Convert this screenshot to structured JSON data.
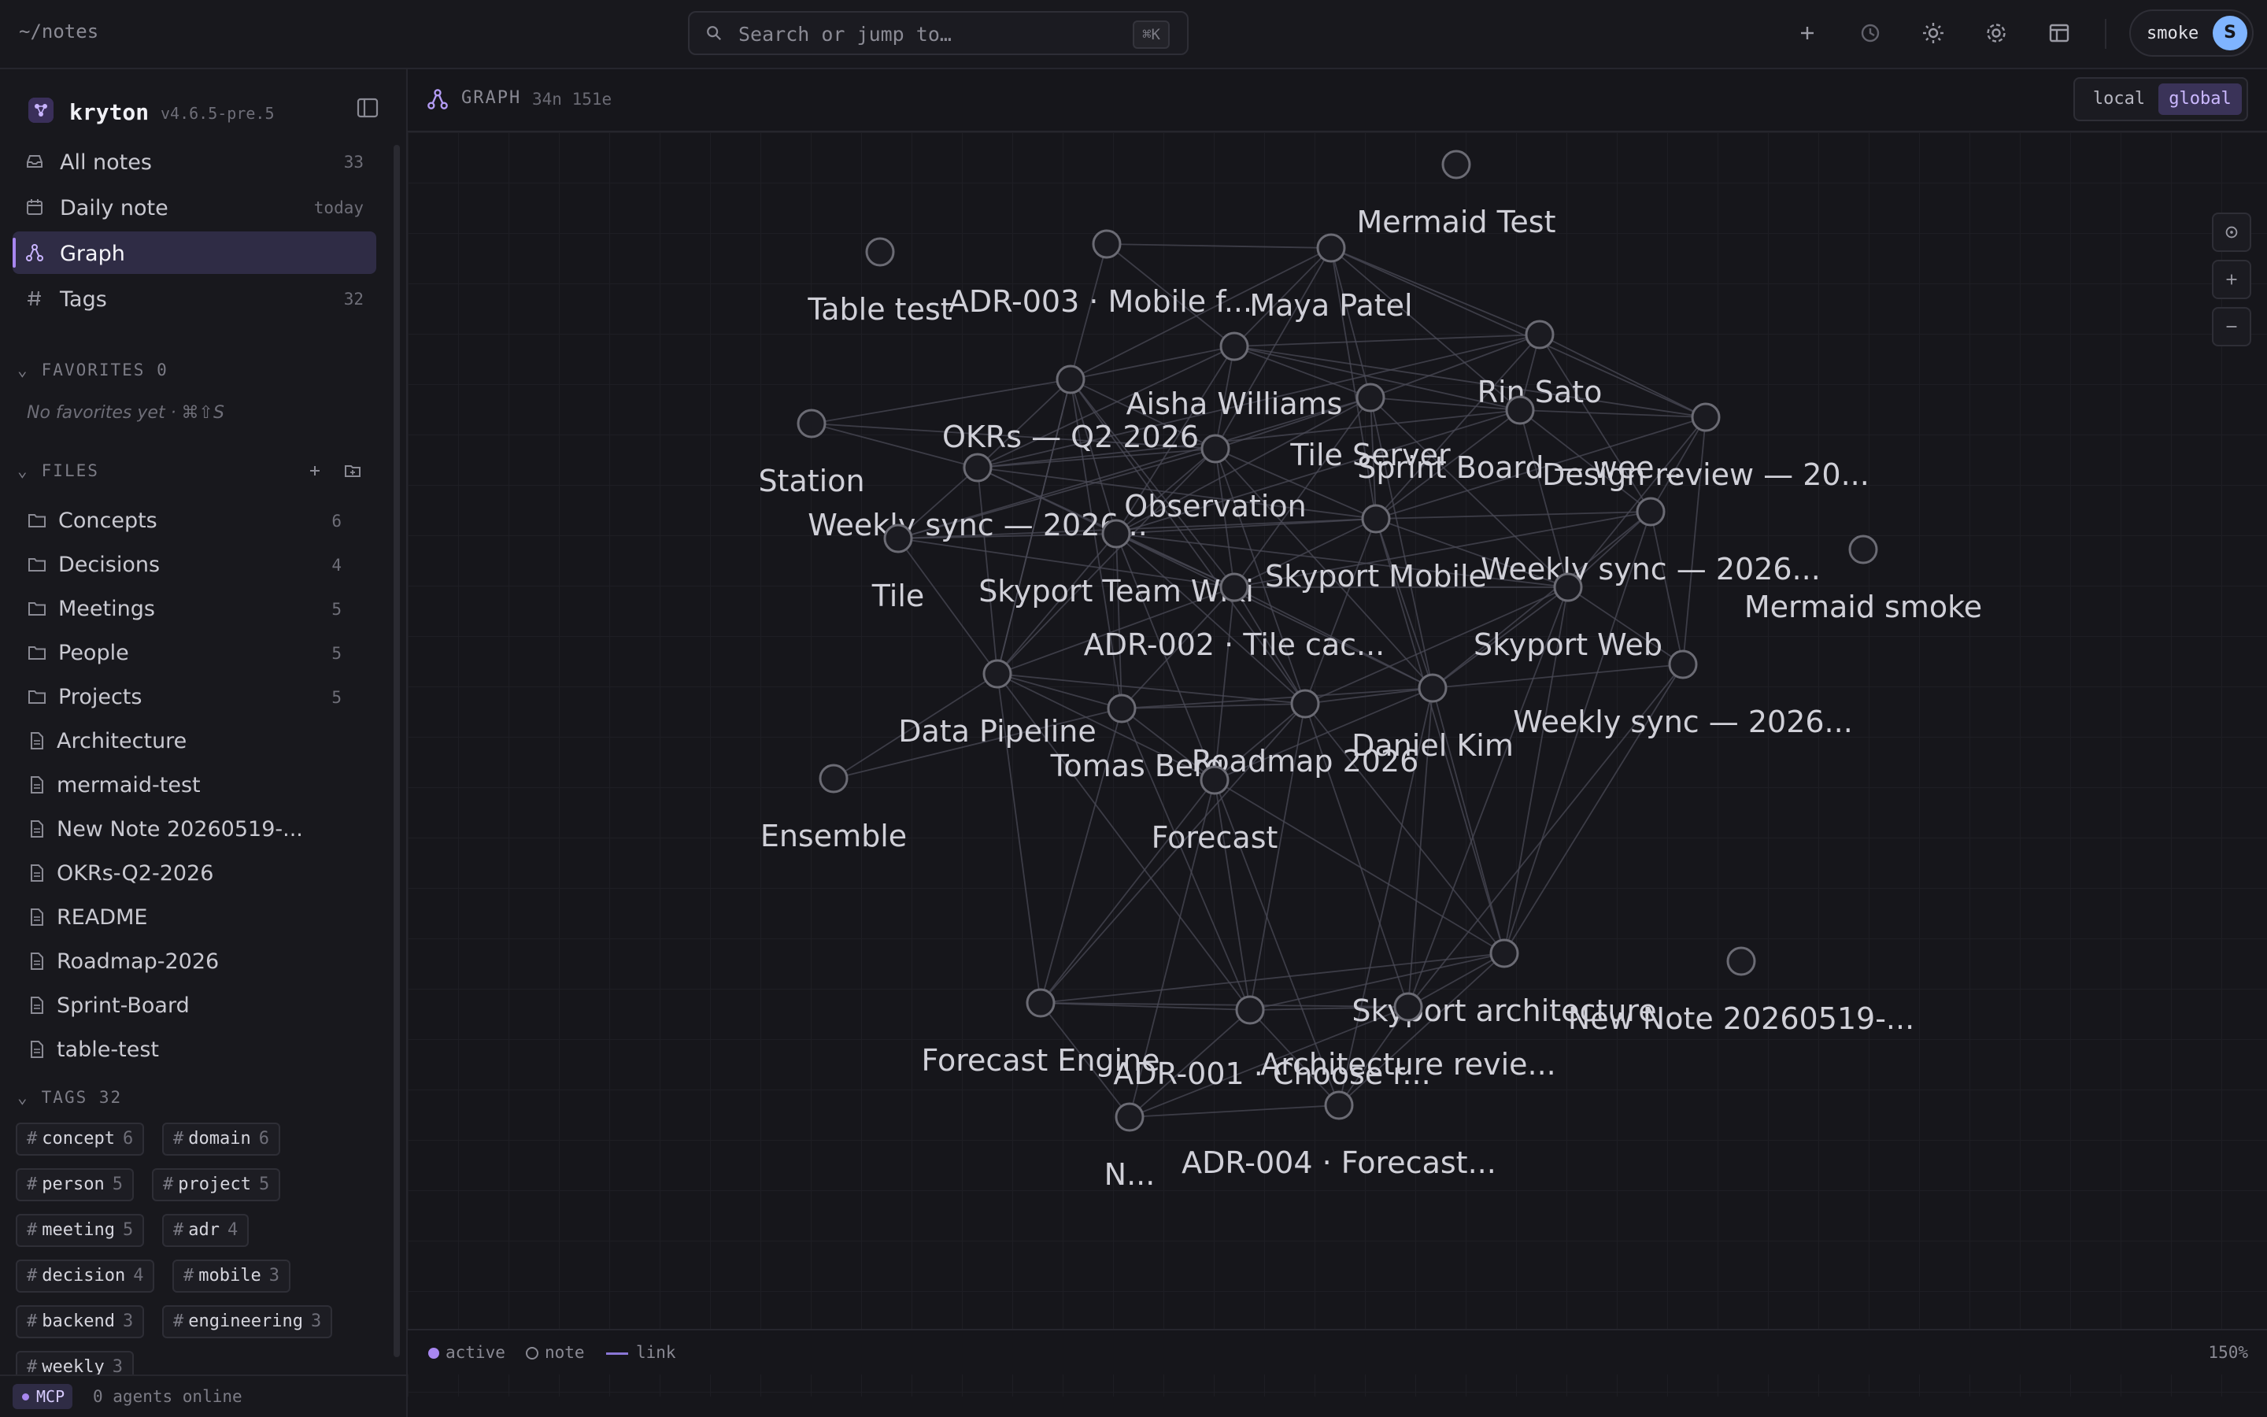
{
  "topbar": {
    "path": "~/notes",
    "search_placeholder": "Search or jump to…",
    "search_shortcut": "⌘K",
    "user_name": "smoke",
    "avatar_initial": "S"
  },
  "sidebar": {
    "app_name": "kryton",
    "version": "v4.6.5-pre.5",
    "nav": [
      {
        "label": "All notes",
        "count": "33",
        "icon": "inbox-icon"
      },
      {
        "label": "Daily note",
        "count": "today",
        "icon": "calendar-icon"
      },
      {
        "label": "Graph",
        "count": "",
        "icon": "graph-icon",
        "active": true
      },
      {
        "label": "Tags",
        "count": "32",
        "icon": "hash-icon"
      }
    ],
    "favorites_title": "FAVORITES",
    "favorites_count": "0",
    "favorites_empty": "No favorites yet · ⌘⇧S",
    "files_title": "FILES",
    "folders": [
      {
        "label": "Concepts",
        "count": "6"
      },
      {
        "label": "Decisions",
        "count": "4"
      },
      {
        "label": "Meetings",
        "count": "5"
      },
      {
        "label": "People",
        "count": "5"
      },
      {
        "label": "Projects",
        "count": "5"
      }
    ],
    "files": [
      "Architecture",
      "mermaid-test",
      "New Note 20260519-...",
      "OKRs-Q2-2026",
      "README",
      "Roadmap-2026",
      "Sprint-Board",
      "table-test"
    ],
    "tags_title": "TAGS",
    "tags_count": "32",
    "tags": [
      {
        "name": "concept",
        "count": "6"
      },
      {
        "name": "domain",
        "count": "6"
      },
      {
        "name": "person",
        "count": "5"
      },
      {
        "name": "project",
        "count": "5"
      },
      {
        "name": "meeting",
        "count": "5"
      },
      {
        "name": "adr",
        "count": "4"
      },
      {
        "name": "decision",
        "count": "4"
      },
      {
        "name": "mobile",
        "count": "3"
      },
      {
        "name": "backend",
        "count": "3"
      },
      {
        "name": "engineering",
        "count": "3"
      },
      {
        "name": "weekly",
        "count": "3"
      }
    ]
  },
  "statusbar": {
    "mcp_label": "MCP",
    "agents": "0 agents online"
  },
  "graph": {
    "title": "GRAPH",
    "stats": "34n 151e",
    "toggle_local": "local",
    "toggle_global": "global",
    "legend_active": "active",
    "legend_note": "note",
    "legend_link": "link",
    "zoom": "150%",
    "colors": {
      "node_stroke": "#6b6b74",
      "edge": "#4a4a55",
      "label": "#d0d0d8",
      "accent": "#a887f0"
    },
    "nodes": [
      {
        "id": "mermaid-test",
        "label": "Mermaid Test"
      },
      {
        "id": "table-test",
        "label": "Table test"
      },
      {
        "id": "adr-003",
        "label": "ADR-003 · Mobile f..."
      },
      {
        "id": "maya",
        "label": "Maya Patel"
      },
      {
        "id": "rin",
        "label": "Rin Sato"
      },
      {
        "id": "aisha",
        "label": "Aisha Williams"
      },
      {
        "id": "okrs",
        "label": "OKRs — Q2 2026"
      },
      {
        "id": "station",
        "label": "Station"
      },
      {
        "id": "tileserver",
        "label": "Tile Server"
      },
      {
        "id": "sprint",
        "label": "Sprint Board — wee..."
      },
      {
        "id": "design",
        "label": "Design review — 20..."
      },
      {
        "id": "observation",
        "label": "Observation"
      },
      {
        "id": "weekly1",
        "label": "Weekly sync — 2026..."
      },
      {
        "id": "tile",
        "label": "Tile"
      },
      {
        "id": "wiki",
        "label": "Skyport Team Wiki"
      },
      {
        "id": "mobile",
        "label": "Skyport Mobile"
      },
      {
        "id": "weekly2",
        "label": "Weekly sync — 2026..."
      },
      {
        "id": "mermaid-smoke",
        "label": "Mermaid smoke"
      },
      {
        "id": "adr-002",
        "label": "ADR-002 · Tile cac..."
      },
      {
        "id": "web",
        "label": "Skyport Web"
      },
      {
        "id": "weekly3",
        "label": "Weekly sync — 2026..."
      },
      {
        "id": "pipeline",
        "label": "Data Pipeline"
      },
      {
        "id": "daniel",
        "label": "Daniel Kim"
      },
      {
        "id": "tomas",
        "label": "Tomas Berg"
      },
      {
        "id": "roadmap",
        "label": "Roadmap 2026"
      },
      {
        "id": "ensemble",
        "label": "Ensemble"
      },
      {
        "id": "forecast",
        "label": "Forecast"
      },
      {
        "id": "architecture",
        "label": "Skyport architecture"
      },
      {
        "id": "newnote",
        "label": "New Note 20260519-..."
      },
      {
        "id": "engine",
        "label": "Forecast Engine"
      },
      {
        "id": "adr-001",
        "label": "ADR-001 · Choose r..."
      },
      {
        "id": "archreview",
        "label": "Architecture revie..."
      },
      {
        "id": "readme",
        "label": "N..."
      },
      {
        "id": "adr-004",
        "label": "ADR-004 · Forecast..."
      }
    ]
  }
}
